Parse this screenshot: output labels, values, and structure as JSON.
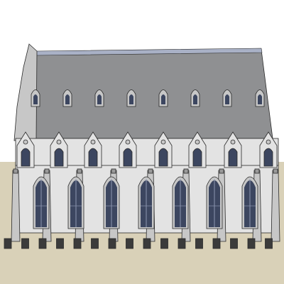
{
  "scene": {
    "subject": "gothic-hall-model",
    "colors": {
      "sky": "#ffffff",
      "ground": "#d9d1b8",
      "roof": "#8f9092",
      "roof_shade": "#7d7e80",
      "roof_ridge": "#a9b1c6",
      "wall": "#e3e3e3",
      "wall_shade": "#c7c7c7",
      "stone_dark": "#9a9a9a",
      "outline": "#2a2a2a",
      "glass": "#3c4660",
      "glass_light": "#8d97b1",
      "plinth": "#3b3b3b"
    }
  }
}
